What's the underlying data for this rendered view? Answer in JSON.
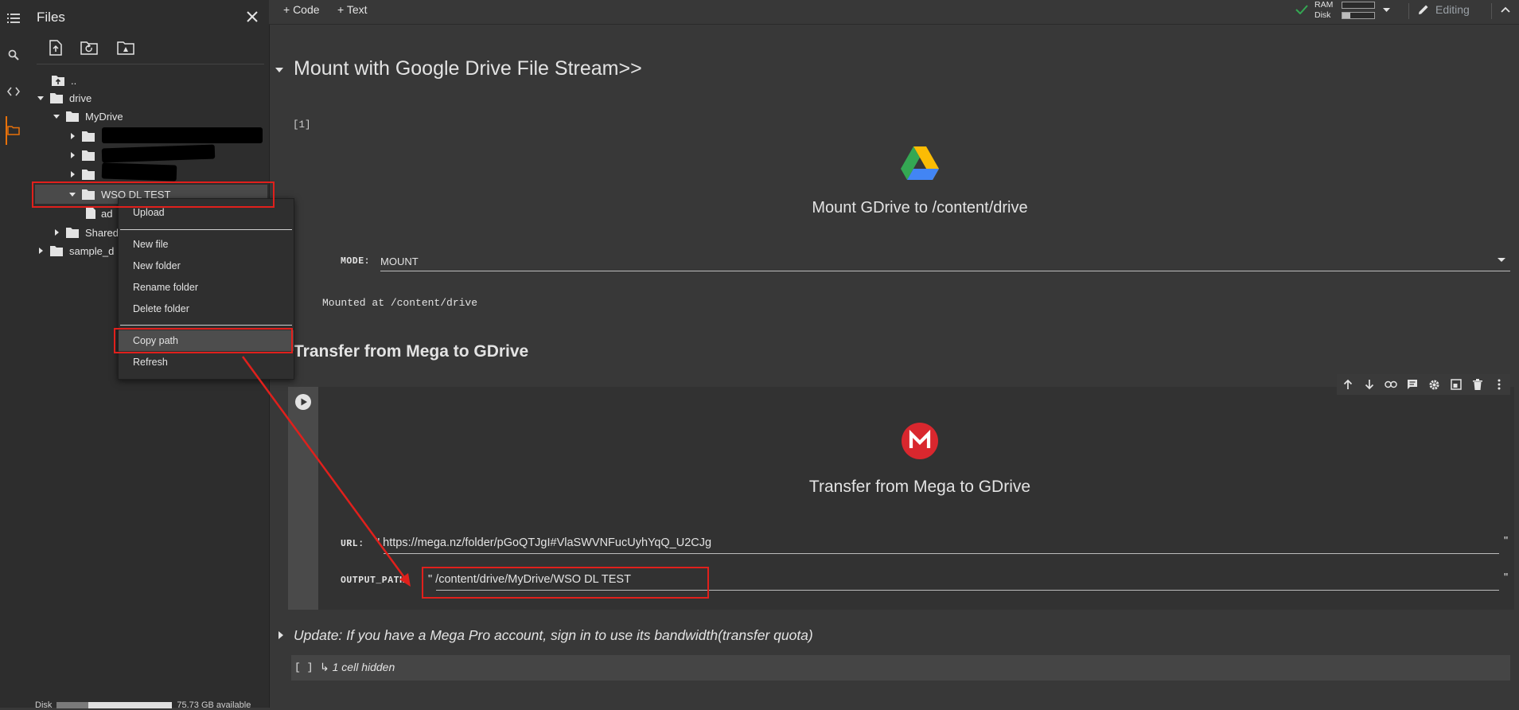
{
  "files_panel": {
    "title": "Files",
    "tree": {
      "up": "..",
      "drive": "drive",
      "mydrive": "MyDrive",
      "wso_folder": "WSO DL TEST",
      "ad_file": "ad",
      "shared": "Shared",
      "sample": "sample_d"
    },
    "disk_label": "Disk",
    "disk_available": "75.73 GB available",
    "disk_fraction": 0.27
  },
  "context_menu": {
    "upload": "Upload",
    "new_file": "New file",
    "new_folder": "New folder",
    "rename_folder": "Rename folder",
    "delete_folder": "Delete folder",
    "copy_path": "Copy path",
    "refresh": "Refresh"
  },
  "toolbar": {
    "code_label": "+ Code",
    "text_label": "+ Text",
    "ram_label": "RAM",
    "disk_label": "Disk",
    "ram_fraction": 0.0,
    "disk_fraction": 0.25,
    "editing_label": "Editing"
  },
  "notebook": {
    "section1_title": "Mount with Google Drive File Stream>>",
    "cell1_exec_count": "[1]",
    "cell1_heading": "Mount GDrive to /content/drive",
    "mode_label": "MODE:",
    "mode_value": "MOUNT",
    "mount_output": "Mounted at /content/drive",
    "section2_title": "Transfer from Mega to GDrive",
    "cell2_heading": "Transfer from Mega to GDrive",
    "url_label": "URL:",
    "url_value": "\" https://mega.nz/folder/pGoQTJgI#VlaSWVNFucUyhYqQ_U2CJg",
    "output_path_label": "OUTPUT_PATH:",
    "output_path_value": "\" /content/drive/MyDrive/WSO DL TEST",
    "closing_quote": "\"",
    "section3_title": "Update: If you have a Mega Pro account, sign in to use its bandwidth(transfer quota)",
    "hidden_brackets": "[ ]",
    "hidden_cells": "↳ 1 cell hidden"
  },
  "colors": {
    "accent": "#e8710a",
    "annotation_red": "#e0201c",
    "mega_red": "#d9272e",
    "check_green": "#34a853"
  }
}
